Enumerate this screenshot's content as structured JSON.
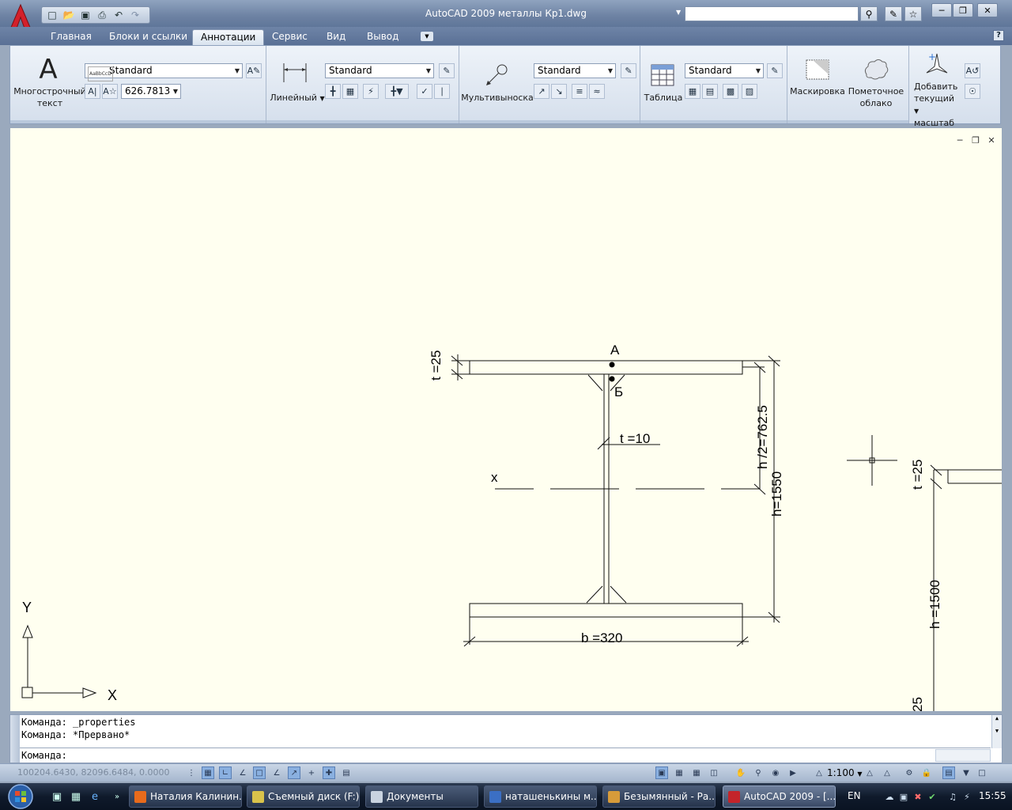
{
  "window": {
    "title": "AutoCAD 2009 металлы Кр1.dwg"
  },
  "quick_access": {
    "icons": [
      "new-icon",
      "open-icon",
      "save-icon",
      "print-icon",
      "undo-icon",
      "redo-icon"
    ]
  },
  "ribbon": {
    "tabs": [
      {
        "label": "Главная",
        "active": false
      },
      {
        "label": "Блоки и ссылки",
        "active": false
      },
      {
        "label": "Аннотации",
        "active": true
      },
      {
        "label": "Сервис",
        "active": false
      },
      {
        "label": "Вид",
        "active": false
      },
      {
        "label": "Вывод",
        "active": false
      }
    ],
    "text_panel": {
      "mtext_label_line1": "Многострочный",
      "mtext_label_line2": "текст",
      "style_value": "Standard",
      "height_value": "626.7813"
    },
    "dim_panel": {
      "linear_label": "Линейный",
      "style_value": "Standard"
    },
    "mleader_panel": {
      "label": "Мультивыноска",
      "style_value": "Standard"
    },
    "table_panel": {
      "label": "Таблица",
      "style_value": "Standard"
    },
    "markup_panel": {
      "wipeout_label": "Маскировка",
      "revcloud_line1": "Пометочное",
      "revcloud_line2": "облако"
    },
    "scale_panel": {
      "line1": "Добавить",
      "line2": "текущий",
      "line3": "масштаб"
    }
  },
  "drawing": {
    "labels": {
      "point_a": "А",
      "point_b": "Б",
      "flange_thickness": "t =25",
      "web_thickness": "t  =10",
      "half_height": "h  /2=762.5",
      "height": "h=1550",
      "width": "b =320",
      "axis_x": "x",
      "ucs_y": "Y",
      "ucs_x": "X",
      "right_flange_thickness": "t =25",
      "right_height": "h =1500",
      "right_bottom": "25"
    }
  },
  "command_line": {
    "history": [
      "Команда: _properties",
      "Команда: *Прервано*"
    ],
    "prompt": "Команда:"
  },
  "status_bar": {
    "coordinates": "100204.6430, 82096.6484, 0.0000",
    "scale": "1:100"
  },
  "taskbar": {
    "tasks": [
      {
        "label": "Наталия Калинин...",
        "color": "#e86b1c",
        "active": false
      },
      {
        "label": "Съемный диск (F:)",
        "color": "#d9c34b",
        "active": false
      },
      {
        "label": "Документы",
        "color": "#c9d3e0",
        "active": false
      },
      {
        "label": "наташенькины м...",
        "color": "#3b6fc4",
        "active": false
      },
      {
        "label": "Безымянный - Ра...",
        "color": "#d79b3a",
        "active": false
      },
      {
        "label": "AutoCAD 2009 - [...",
        "color": "#c4242a",
        "active": true
      }
    ],
    "language": "EN",
    "time": "15:55"
  }
}
